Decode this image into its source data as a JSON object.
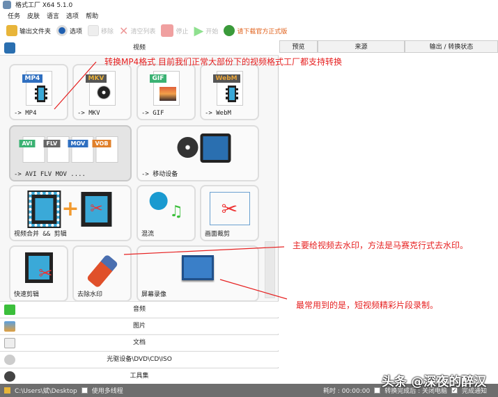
{
  "window": {
    "title": "格式工厂 X64 5.1.0"
  },
  "menu": [
    "任务",
    "皮肤",
    "语言",
    "选项",
    "帮助"
  ],
  "toolbar": {
    "output_folder": "输出文件夹",
    "options": "选项",
    "remove": "移除",
    "clear_list": "清空列表",
    "stop": "停止",
    "start": "开始",
    "download": "请下载官方正式版"
  },
  "video": {
    "header": "视频",
    "tiles": [
      {
        "label": "-> MP4",
        "tag": "MP4"
      },
      {
        "label": "-> MKV",
        "tag": "MKV"
      },
      {
        "label": "-> GIF",
        "tag": "GIF"
      },
      {
        "label": "-> WebM",
        "tag": "WebM"
      },
      {
        "label": "-> AVI FLV MOV ....",
        "tags": [
          "AVI",
          "FLV",
          "MOV",
          "VOB"
        ]
      },
      {
        "label": "-> 移动设备"
      },
      {
        "label": "视频合并 && 剪辑"
      },
      {
        "label": "混流"
      },
      {
        "label": "画面裁剪"
      },
      {
        "label": "快速剪辑"
      },
      {
        "label": "去除水印"
      },
      {
        "label": "屏幕录像"
      }
    ]
  },
  "categories": [
    "音频",
    "图片",
    "文档",
    "光驱设备\\DVD\\CD\\ISO",
    "工具集"
  ],
  "task_table": {
    "columns": [
      "预览",
      "来源",
      "输出 / 转换状态"
    ]
  },
  "status": {
    "path": "C:\\Users\\斌\\Desktop",
    "multithread": "使用多线程",
    "elapsed": "耗时 : 00:00:00",
    "shutdown": "转换完成后 : 关闭电脑",
    "notify": "完成通知"
  },
  "annotations": [
    "转换MP4格式   目前我们正常大部份下的视频格式工厂都支持转换",
    "主要给视频去水印，方法是马赛克行式去水印。",
    "最常用到的是，短视频精彩片段录制。"
  ],
  "watermark": "头条 @深夜的醉汉"
}
